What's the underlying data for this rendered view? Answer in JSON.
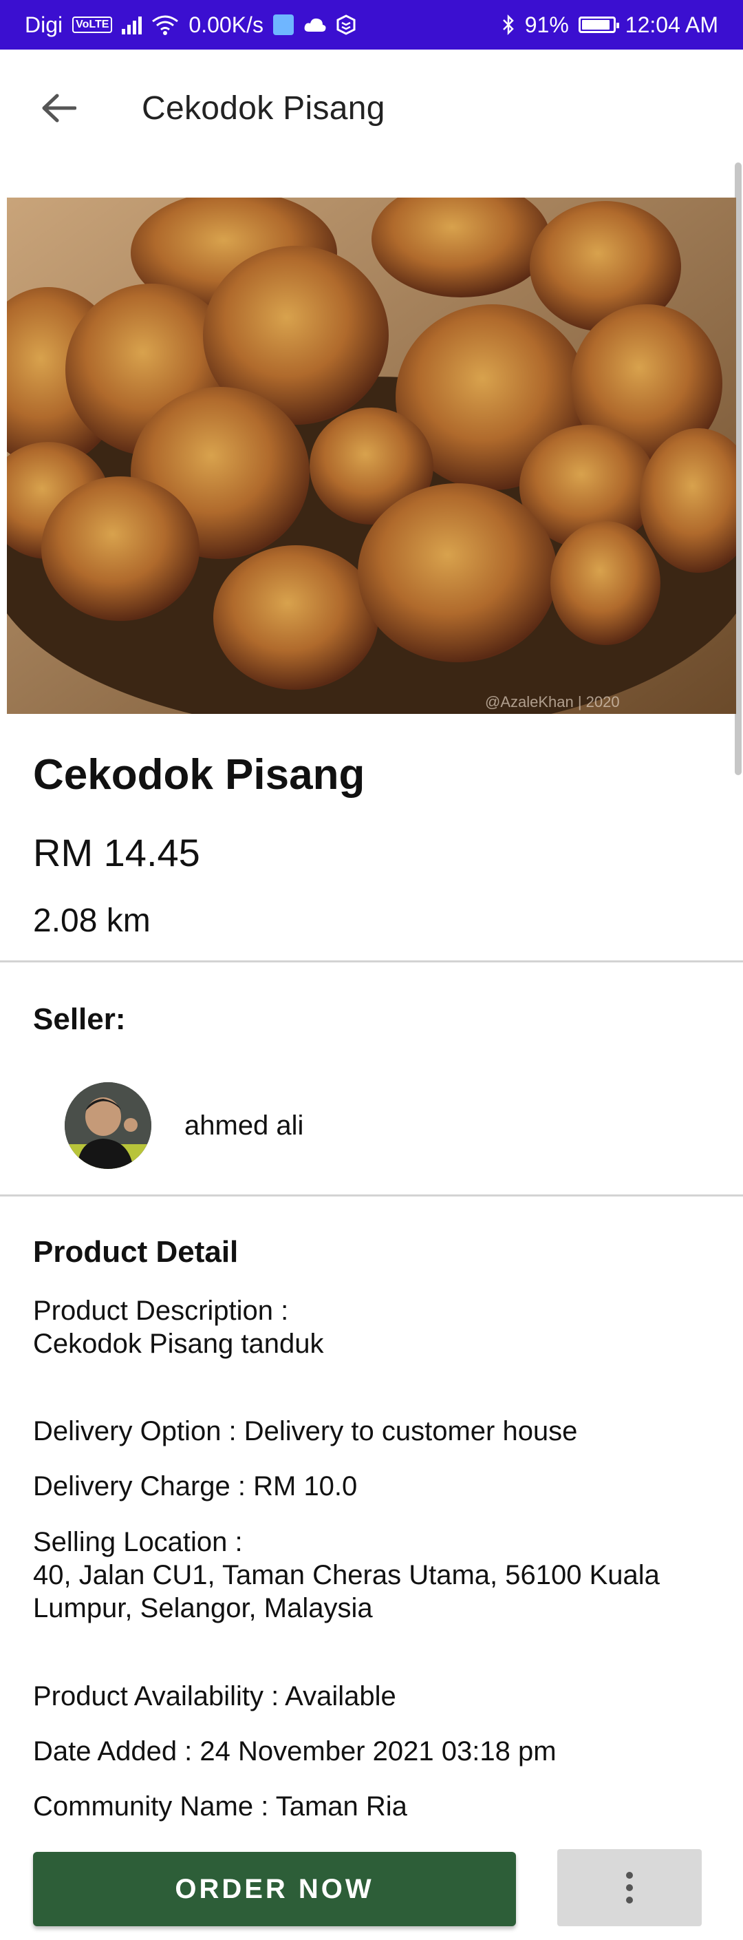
{
  "status_bar": {
    "carrier": "Digi",
    "volte": "VoLTE",
    "speed": "0.00K/s",
    "battery": "91%",
    "battery_level": 0.91,
    "time": "12:04 AM",
    "color": "#3b0fd0"
  },
  "app_bar": {
    "title": "Cekodok Pisang",
    "back_icon": "arrow-left-icon"
  },
  "product": {
    "name": "Cekodok Pisang",
    "price": "RM 14.45",
    "distance": "2.08 km",
    "image_watermark": "@AzaleKhan | 2020"
  },
  "seller": {
    "label": "Seller:",
    "name": "ahmed ali"
  },
  "details": {
    "heading": "Product Detail",
    "description_label": "Product Description :",
    "description_value": "Cekodok Pisang tanduk",
    "delivery_option": "Delivery Option : Delivery to customer house",
    "delivery_charge": "Delivery Charge : RM 10.0",
    "location_label": "Selling Location :",
    "location_value": "40, Jalan CU1, Taman Cheras Utama, 56100 Kuala Lumpur, Selangor, Malaysia",
    "availability": "Product Availability : Available",
    "date_added": "Date Added : 24 November 2021 03:18 pm",
    "community": "Community Name : Taman Ria"
  },
  "actions": {
    "order_label": "ORDER NOW",
    "order_color": "#2d5e38",
    "more_icon": "more-vertical-icon"
  }
}
